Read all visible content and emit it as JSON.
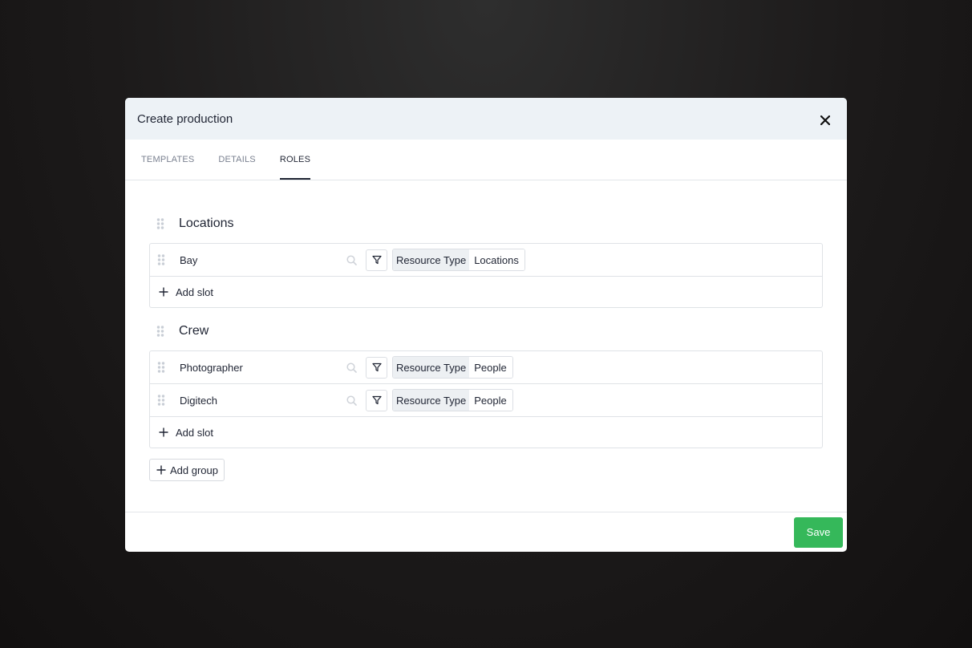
{
  "modal": {
    "title": "Create production",
    "close_icon": "close-icon"
  },
  "tabs": [
    {
      "label": "TEMPLATES",
      "active": false
    },
    {
      "label": "DETAILS",
      "active": false
    },
    {
      "label": "ROLES",
      "active": true
    }
  ],
  "groups": [
    {
      "title": "Locations",
      "slots": [
        {
          "name": "Bay",
          "filter_key": "Resource Type",
          "filter_value": "Locations"
        }
      ],
      "add_slot_label": "Add slot"
    },
    {
      "title": "Crew",
      "slots": [
        {
          "name": "Photographer",
          "filter_key": "Resource Type",
          "filter_value": "People"
        },
        {
          "name": "Digitech",
          "filter_key": "Resource Type",
          "filter_value": "People"
        }
      ],
      "add_slot_label": "Add slot"
    }
  ],
  "add_group_label": "Add group",
  "footer": {
    "save_label": "Save"
  },
  "colors": {
    "save_button": "#35b85a",
    "header_bg": "#edf2f6",
    "text": "#1f2433"
  }
}
